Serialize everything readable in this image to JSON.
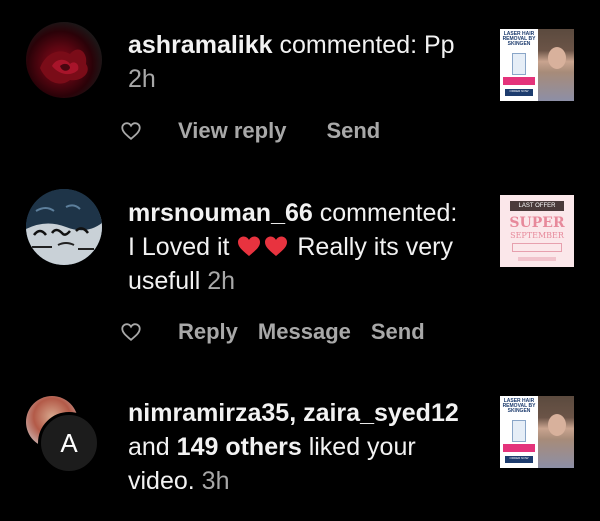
{
  "notifications": [
    {
      "username": "ashramalikk",
      "text": "commented: Pp",
      "time": "2h",
      "actions": [
        "View reply",
        "Send"
      ],
      "avatar_icon": "rose-avatar",
      "thumbnail": {
        "type": "laser-ad",
        "title": "LASER HAIR REMOVAL BY SKINGEN",
        "order": "ORDER NOW"
      }
    },
    {
      "username": "mrsnouman_66",
      "text_before": "commented:",
      "text_line2": "I Loved it",
      "text_after": "Really its very",
      "text_line3": "usefull",
      "time": "2h",
      "actions": [
        "Reply",
        "Message",
        "Send"
      ],
      "avatar_icon": "calligraphy-avatar",
      "thumbnail": {
        "type": "promo",
        "last_offer": "LAST OFFER",
        "super": "SUPER",
        "september": "SEPTEMBER"
      }
    },
    {
      "users": "nimramirza35, zaira_syed12",
      "and": "and",
      "others": "149 others",
      "text_after": "liked your",
      "text_line3": "video.",
      "time": "3h",
      "avatar_letter": "A",
      "thumbnail": {
        "type": "laser-ad",
        "title": "LASER HAIR REMOVAL BY SKINGEN",
        "order": "ORDER NOW"
      }
    }
  ],
  "colors": {
    "background": "#000000",
    "text": "#f2f2f2",
    "muted": "#a8a8a8",
    "heart_emoji": "#e8333f"
  }
}
